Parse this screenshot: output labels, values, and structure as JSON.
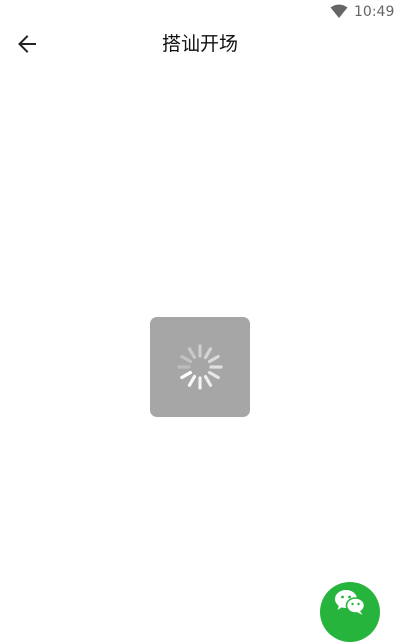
{
  "status_bar": {
    "time": "10:49",
    "wifi_icon": "wifi-icon"
  },
  "app_bar": {
    "back_icon": "arrow-left-icon",
    "title": "搭讪开场"
  },
  "loading": {
    "icon": "spinner-icon"
  },
  "fab": {
    "icon": "wechat-icon",
    "color": "#27b43c"
  }
}
